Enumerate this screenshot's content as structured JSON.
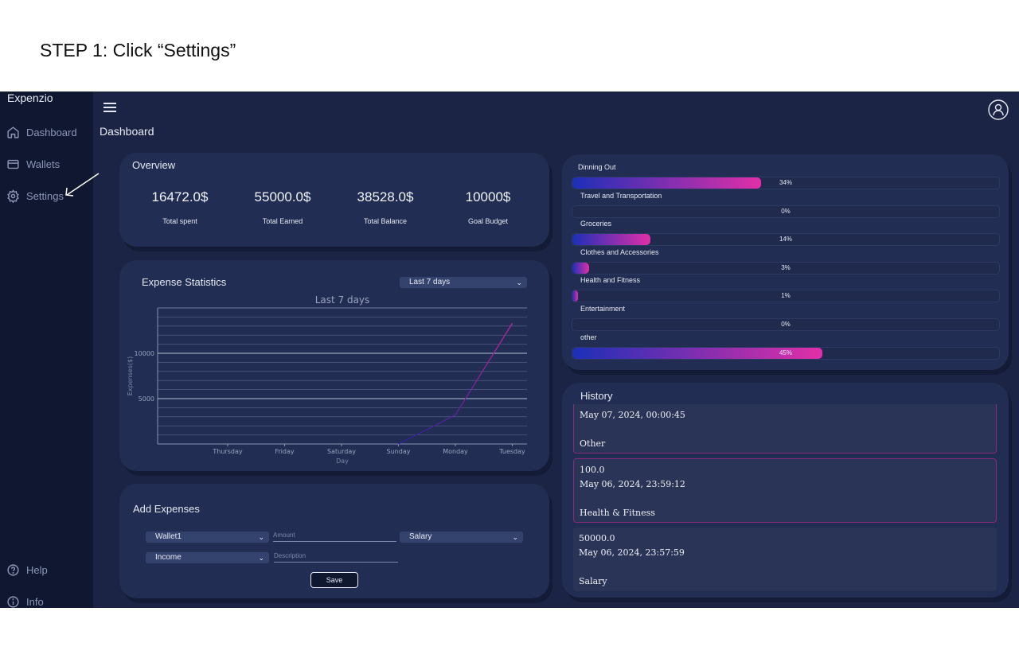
{
  "step": {
    "title": "STEP 1: Click “Settings”"
  },
  "app": {
    "brand": "Expenzio",
    "page_title": "Dashboard"
  },
  "sidebar": {
    "items": [
      {
        "label": "Dashboard",
        "icon": "home-icon"
      },
      {
        "label": "Wallets",
        "icon": "wallet-icon"
      },
      {
        "label": "Settings",
        "icon": "gear-icon"
      }
    ],
    "footer": [
      {
        "label": "Help",
        "icon": "help-icon"
      },
      {
        "label": "Info",
        "icon": "info-icon"
      }
    ]
  },
  "overview": {
    "title": "Overview",
    "stats": [
      {
        "value": "16472.0$",
        "label": "Total spent"
      },
      {
        "value": "55000.0$",
        "label": "Total Earned"
      },
      {
        "value": "38528.0$",
        "label": "Total Balance"
      },
      {
        "value": "10000$",
        "label": "Goal Budget"
      }
    ]
  },
  "expense_stats": {
    "title": "Expense Statistics",
    "range_select": "Last 7 days"
  },
  "chart_data": {
    "type": "line",
    "title": "Last 7 days",
    "xlabel": "Day",
    "ylabel": "Expenses($)",
    "categories": [
      "Thursday",
      "Friday",
      "Saturday",
      "Sunday",
      "Monday",
      "Tuesday"
    ],
    "y_ticks": [
      "5000",
      "10000"
    ],
    "values": [
      0,
      0,
      0,
      0,
      3200,
      13300
    ],
    "ylim": [
      0,
      15000
    ],
    "grid": true,
    "line_colors": [
      "#2a1fa0",
      "#c2259c"
    ]
  },
  "categories": [
    {
      "label": "Dinning Out",
      "pct": 34,
      "pct_label": "34%"
    },
    {
      "label": "Travel and Transportation",
      "pct": 0,
      "pct_label": "0%"
    },
    {
      "label": "Groceries",
      "pct": 14,
      "pct_label": "14%"
    },
    {
      "label": "Clothes and Accessories",
      "pct": 3,
      "pct_label": "3%"
    },
    {
      "label": "Health  and Fitness",
      "pct": 1,
      "pct_label": "1%"
    },
    {
      "label": "Entertainment",
      "pct": 0,
      "pct_label": "0%"
    },
    {
      "label": "other",
      "pct": 45,
      "pct_label": "45%"
    }
  ],
  "history": {
    "title": "History",
    "items": [
      {
        "amount": "",
        "date": "May 07, 2024, 00:00:45",
        "category": "Other"
      },
      {
        "amount": "100.0",
        "date": "May 06, 2024, 23:59:12",
        "category": "Health & Fitness"
      },
      {
        "amount": "50000.0",
        "date": "May 06, 2024, 23:57:59",
        "category": "Salary"
      }
    ]
  },
  "add_expenses": {
    "title": "Add Expenses",
    "wallet_select": "Wallet1",
    "type_select": "Income",
    "category_select": "Salary",
    "amount_placeholder": "Amount",
    "description_placeholder": "Description",
    "save_label": "Save"
  },
  "colors": {
    "background": "#1b2444",
    "sidebar": "#0f1731",
    "card": "#212d52",
    "bar_gradient_start": "#1c2fb8",
    "bar_gradient_end": "#e22fa8"
  }
}
